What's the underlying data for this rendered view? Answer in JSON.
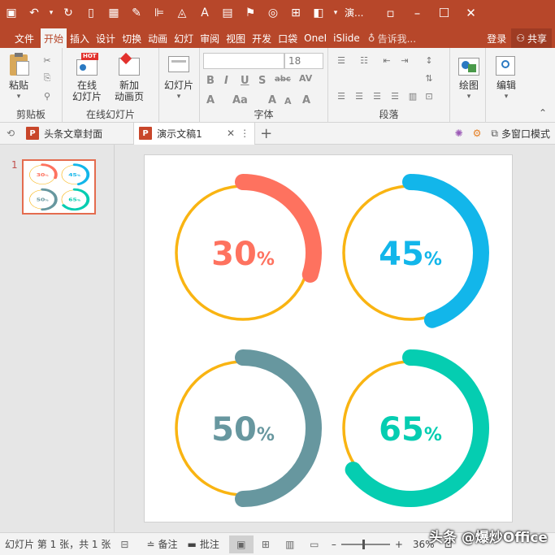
{
  "titlebar": {
    "doc_title": "演...",
    "restore_glyph": "▫",
    "minimize_glyph": "–",
    "maximize_glyph": "☐",
    "close_glyph": "✕"
  },
  "tabs": [
    {
      "label": "文件"
    },
    {
      "label": "开始"
    },
    {
      "label": "插入"
    },
    {
      "label": "设计"
    },
    {
      "label": "切换"
    },
    {
      "label": "动画"
    },
    {
      "label": "幻灯"
    },
    {
      "label": "审阅"
    },
    {
      "label": "视图"
    },
    {
      "label": "开发"
    },
    {
      "label": "口袋"
    },
    {
      "label": "OneI"
    },
    {
      "label": "iSlide"
    }
  ],
  "tell_me": "告诉我...",
  "login": "登录",
  "share": "共享",
  "ribbon": {
    "paste": "粘贴",
    "clipboard_group": "剪贴板",
    "online_slides_line1": "在线",
    "online_slides_line2": "幻灯片",
    "hot_badge": "HOT",
    "new_anim_line1": "新加",
    "new_anim_line2": "动画页",
    "online_group": "在线幻灯片",
    "slides_btn": "幻灯片",
    "font_size": "18",
    "font_group": "字体",
    "para_group": "段落",
    "draw_btn": "绘图",
    "edit_btn": "编辑"
  },
  "doc_tabs": {
    "tab1": "头条文章封面",
    "tab2": "演示文稿1",
    "close": "✕",
    "more": "⋮",
    "add": "+",
    "multi_window": "多窗口模式"
  },
  "thumbnail": {
    "number": "1"
  },
  "chart_data": {
    "type": "pie",
    "track_color": "#f9b412",
    "items": [
      {
        "label": "30",
        "unit": "%",
        "value": 30,
        "color": "#fe725f"
      },
      {
        "label": "45",
        "unit": "%",
        "value": 45,
        "color": "#12b6ea"
      },
      {
        "label": "50",
        "unit": "%",
        "value": 50,
        "color": "#67979f"
      },
      {
        "label": "65",
        "unit": "%",
        "value": 65,
        "color": "#05cdb1"
      }
    ]
  },
  "statusbar": {
    "slide_info": "幻灯片 第 1 张，共 1 张",
    "notes": "备注",
    "comments": "批注",
    "zoom": "36%"
  },
  "watermark": "头条 @爆炒Office"
}
